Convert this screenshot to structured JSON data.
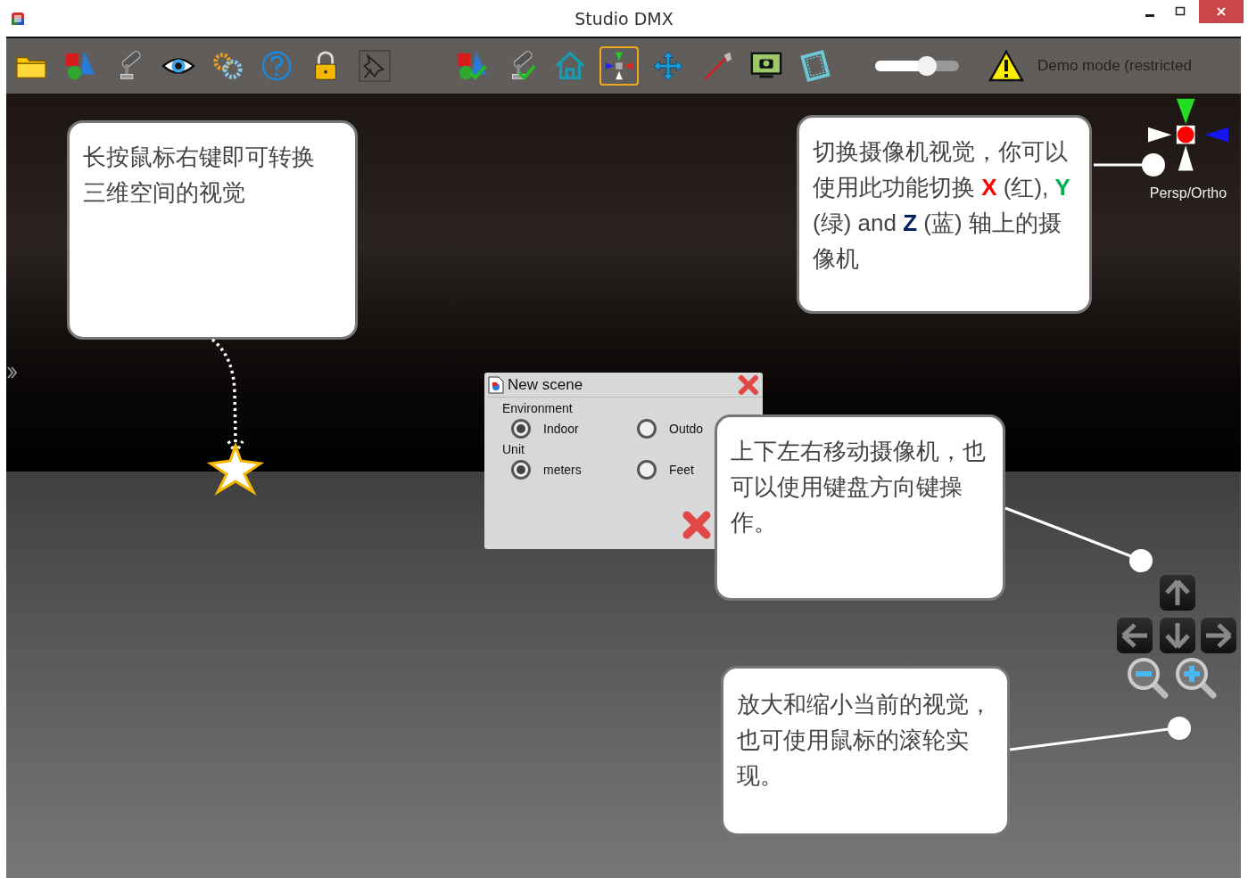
{
  "window": {
    "title": "Studio DMX"
  },
  "toolbar": [
    {
      "kind": "folder",
      "selected": false
    },
    {
      "kind": "shapes",
      "selected": false
    },
    {
      "kind": "spotlight",
      "selected": false
    },
    {
      "kind": "eye",
      "selected": false
    },
    {
      "kind": "gears",
      "selected": false
    },
    {
      "kind": "help",
      "selected": false
    },
    {
      "kind": "lock",
      "selected": false
    },
    {
      "kind": "pin",
      "selected": false
    },
    {
      "kind": "shapes-check",
      "selected": false
    },
    {
      "kind": "spotlight-check",
      "selected": false
    },
    {
      "kind": "home",
      "selected": false
    },
    {
      "kind": "camera-axes",
      "selected": true
    },
    {
      "kind": "move",
      "selected": false
    },
    {
      "kind": "laser",
      "selected": false
    },
    {
      "kind": "monitor",
      "selected": false
    },
    {
      "kind": "film",
      "selected": false
    }
  ],
  "zoom_slider": {
    "level": 0.62
  },
  "status": {
    "text": "Demo mode (restricted"
  },
  "gizmo": {
    "label": "Persp/Ortho"
  },
  "dialog": {
    "title": "New scene",
    "groups": [
      {
        "label": "Environment",
        "options": [
          {
            "label": "Indoor",
            "selected": true
          },
          {
            "label": "Outdo",
            "selected": false
          }
        ]
      },
      {
        "label": "Unit",
        "options": [
          {
            "label": "meters",
            "selected": true
          },
          {
            "label": "Feet",
            "selected": false
          }
        ]
      }
    ]
  },
  "callouts": [
    {
      "segments": [
        {
          "text": "长按鼠标右键即可转换三维空间的视觉"
        }
      ]
    },
    {
      "segments": [
        {
          "text": "切换摄像机视觉，你可以使用此功能切换 "
        },
        {
          "text": "X",
          "color": "#ff0000"
        },
        {
          "text": " (红), "
        },
        {
          "text": "Y",
          "color": "#00b050"
        },
        {
          "text": " (绿) and "
        },
        {
          "text": "Z",
          "color": "#002060"
        },
        {
          "text": " (蓝) 轴上的摄像机"
        }
      ]
    },
    {
      "segments": [
        {
          "text": "上下左右移动摄像机，也可以使用键盘方向键操作。"
        }
      ]
    },
    {
      "segments": [
        {
          "text": "放大和缩小当前的视觉，也可使用鼠标的滚轮实现。"
        }
      ]
    }
  ],
  "navigation": [
    {
      "kind": "up"
    },
    {
      "kind": "left"
    },
    {
      "kind": "down"
    },
    {
      "kind": "right"
    },
    {
      "kind": "zoom-out"
    },
    {
      "kind": "zoom-in"
    }
  ]
}
